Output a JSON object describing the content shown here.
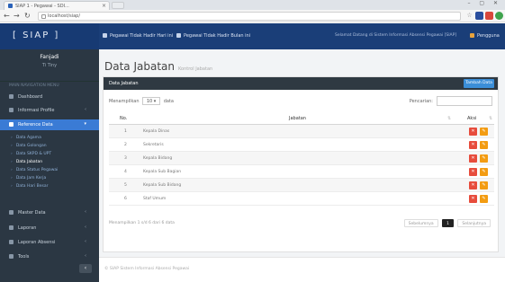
{
  "browser": {
    "tab_title": "SIAP 1 - Pegawai - SDI...",
    "url": "localhost/siap/",
    "window_controls": "–  ▢  ✕"
  },
  "topnav": {
    "brand": "[ SIAP ]",
    "item1": "Pegawai Tidak Hadir Hari ini",
    "item2": "Pegawai Tidak Hadir Bulan ini",
    "info_text": "Selamat Datang di Sistem Informasi Absensi Pegawai [SIAP]",
    "user": "Pengguna"
  },
  "sidebar": {
    "name": "Fanjadi",
    "role": "Ti Tiny",
    "header": "MAIN NAVIGATION MENU",
    "items": [
      {
        "label": "Dashboard"
      },
      {
        "label": "Informasi Profile"
      },
      {
        "label": "Reference Data"
      },
      {
        "label": "Master Data"
      },
      {
        "label": "Laporan"
      },
      {
        "label": "Laporan Absensi"
      },
      {
        "label": "Tools"
      }
    ],
    "sub_items": [
      "Data Agama",
      "Data Golongan",
      "Data SKPD & UPT",
      "Data Jabatan",
      "Data Status Pegawai",
      "Data Jam Kerja",
      "Data Hari Besar"
    ],
    "collapse": "‹"
  },
  "main": {
    "title": "Data Jabatan",
    "subtitle": "Kontrol Jabatan",
    "box_title": "Data Jabatan",
    "add_button": "Tambah Data",
    "show_prefix": "Menampilkan",
    "show_value": "10",
    "show_suffix": "data",
    "search_label": "Pencarian:",
    "columns": [
      "No.",
      "Jabatan",
      "Aksi"
    ],
    "rows": [
      {
        "no": "1",
        "jabatan": "Kepala Dinas"
      },
      {
        "no": "2",
        "jabatan": "Sekretaris"
      },
      {
        "no": "3",
        "jabatan": "Kepala Bidang"
      },
      {
        "no": "4",
        "jabatan": "Kepala Sub Bagian"
      },
      {
        "no": "5",
        "jabatan": "Kepala Sub Bidang"
      },
      {
        "no": "6",
        "jabatan": "Staf Umum"
      }
    ],
    "info": "Menampilkan 1 s/d 6 dari 6 data",
    "pager_prev": "Sebelumnya",
    "pager_current": "1",
    "pager_next": "Selanjutnya",
    "footer": "© SIAP Sistem Informasi Absensi Pegawai"
  }
}
